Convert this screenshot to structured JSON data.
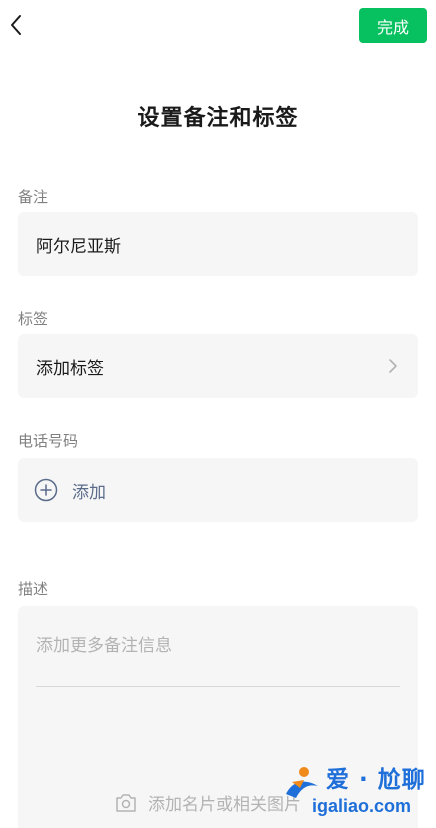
{
  "header": {
    "back_icon": "chevron-left-icon",
    "done_label": "完成",
    "accent_color": "#07c160"
  },
  "page": {
    "title": "设置备注和标签"
  },
  "remark": {
    "label": "备注",
    "value": "阿尔尼亚斯"
  },
  "tags": {
    "label": "标签",
    "action_label": "添加标签",
    "chevron_icon": "chevron-right-icon"
  },
  "phone": {
    "label": "电话号码",
    "add_label": "添加",
    "add_icon": "plus-circle-icon"
  },
  "description": {
    "label": "描述",
    "placeholder": "添加更多备注信息",
    "photo_icon": "camera-icon",
    "photo_label": "添加名片或相关图片"
  },
  "watermark": {
    "title": "爱 · 尬聊",
    "url": "igaliao.com"
  }
}
